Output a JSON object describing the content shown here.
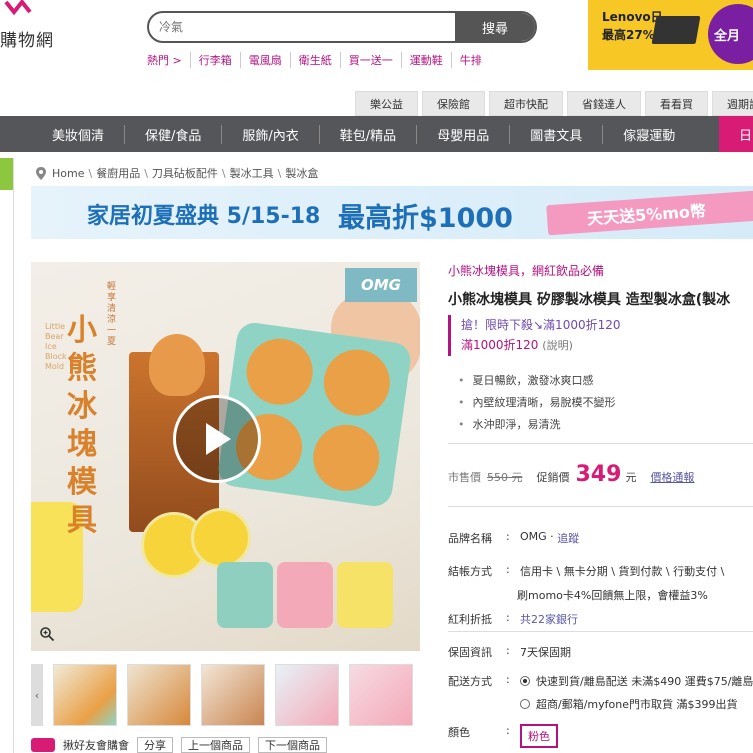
{
  "header": {
    "logo_text": "購物網",
    "search_placeholder": "冷氣",
    "search_button": "搜尋",
    "hot_keywords": [
      "熱門 >",
      "行李箱",
      "電風扇",
      "衛生紙",
      "買一送一",
      "運動鞋",
      "牛排"
    ],
    "ad": {
      "line1": "Lenovo日",
      "line2": "最高27%",
      "badge": "全月"
    }
  },
  "top_tabs": [
    "樂公益",
    "保險館",
    "超市快配",
    "省錢達人",
    "看看買",
    "週期訂購"
  ],
  "categories": [
    "美妝個清",
    "保健/食品",
    "服飾/內衣",
    "鞋包/精品",
    "母嬰用品",
    "圖書文具",
    "傢寢運動"
  ],
  "category_highlight": "日",
  "breadcrumb": [
    "Home",
    "餐廚用品",
    "刀具砧板配件",
    "製冰工具",
    "製冰盒"
  ],
  "sale_banner": {
    "title": "家居初夏盛典 5/15-18",
    "discount": "最高折$1000",
    "ribbon": "天天送5%mo幣"
  },
  "product_image": {
    "brand_badge": "OMG",
    "vertical_title": "小熊冰塊模具",
    "vertical_sub": "輕享清涼一夏",
    "vertical_en": "Little Bear Ice Block Mold"
  },
  "share_bar": {
    "label": "揪好友會購會",
    "share": "分享",
    "prev": "上一個商品",
    "next": "下一個商品"
  },
  "product": {
    "slogan": "小熊冰塊模具，網紅飲品必備",
    "title": "小熊冰塊模具 矽膠製冰模具 造型製冰盒(製冰",
    "promo_line1": "搶！限時下殺↘滿1000折120",
    "promo_line2": "滿1000折120",
    "promo_note": "(說明)",
    "features": [
      "夏日暢飲，激發冰爽口感",
      "內壁紋理清晰，易脫模不變形",
      "水沖即淨，易清洗"
    ],
    "market_label": "市售價",
    "market_price": "550 元",
    "price_label": "促銷價",
    "price": "349",
    "price_unit": "元",
    "price_history": "價格通報"
  },
  "specs": {
    "brand_k": "品牌名稱",
    "brand_v": "OMG",
    "brand_follow": "追蹤",
    "pay_k": "結帳方式",
    "pay_v": "信用卡 \\ 無卡分期 \\ 貨到付款 \\ 行動支付 \\",
    "pay_v2": "刷momo卡4%回饋無上限，會權益3%",
    "bonus_k": "紅利折抵",
    "bonus_v": "共22家銀行",
    "warranty_k": "保固資訊",
    "warranty_v": "7天保固期",
    "ship_k": "配送方式",
    "ship_v1": "快速到貨/離島配送  未滿$490 運費$75/離島",
    "ship_v2": "超商/郵箱/myfone門市取貨  滿$399出貨",
    "color_k": "顏色",
    "color_v": "粉色"
  },
  "colors": {
    "brand_pink": "#b3127f",
    "accent": "#d81b74",
    "cat_bar": "#55565a",
    "link": "#5a57a8"
  }
}
